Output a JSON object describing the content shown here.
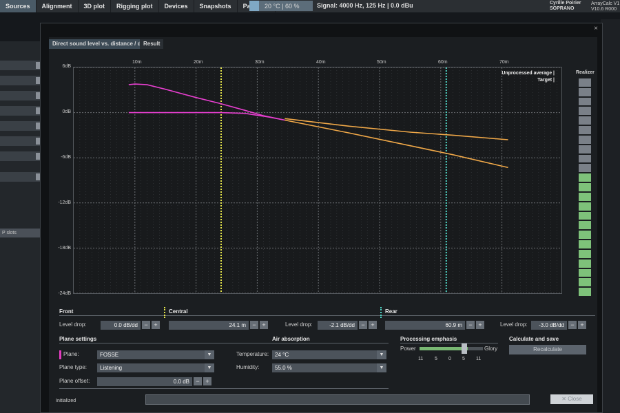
{
  "app": {
    "tabs": [
      "Sources",
      "Alignment",
      "3D plot",
      "Rigging plot",
      "Devices",
      "Snapshots",
      "Parts list"
    ],
    "temperature": "20 °C | 60 %",
    "signal": "Signal: 4000 Hz, 125 Hz | 0.0 dBu",
    "user_line1": "Cyrille Poirier",
    "user_line2": "SOPRANO",
    "app_name": "ArrayCalc V1",
    "version": "V10.6 R000",
    "left_slots_label": "P slots"
  },
  "dialog": {
    "tabs": [
      "Direct sound level vs. distance / dB",
      "Result"
    ],
    "close_x": "×"
  },
  "chart_data": {
    "type": "line",
    "title": "Direct sound level vs. distance / dB",
    "x_ticks": [
      "10m",
      "20m",
      "30m",
      "40m",
      "50m",
      "60m",
      "70m"
    ],
    "y_ticks": [
      "6dB",
      "0dB",
      "-6dB",
      "-12dB",
      "-18dB",
      "-24dB"
    ],
    "xlim": [
      0,
      75
    ],
    "ylim": [
      -24,
      6
    ],
    "series": [
      {
        "name": "Unprocessed average",
        "color": "#e83fd0",
        "x": [
          9,
          10,
          12,
          15,
          20,
          24,
          28,
          31,
          34.5
        ],
        "y": [
          3.7,
          3.8,
          3.7,
          3.1,
          2.0,
          1.2,
          0.3,
          -0.4,
          -1.0
        ]
      },
      {
        "name": "Target",
        "color": "#e83fd0",
        "x": [
          9,
          24,
          28,
          32,
          34.5
        ],
        "y": [
          0,
          0,
          -0.1,
          -0.6,
          -1.0
        ]
      },
      {
        "name": "Unprocessed average",
        "color": "#f0a848",
        "x": [
          34.5,
          45,
          55,
          62,
          71
        ],
        "y": [
          -1.0,
          -2.7,
          -4.4,
          -5.6,
          -7.3
        ]
      },
      {
        "name": "Target",
        "color": "#f0a848",
        "x": [
          34.5,
          45,
          55,
          62,
          71
        ],
        "y": [
          -0.8,
          -1.8,
          -2.6,
          -3.0,
          -3.6
        ]
      }
    ],
    "markers": [
      {
        "x": 24.1,
        "color": "#e6e64a"
      },
      {
        "x": 60.9,
        "color": "#4fd6c6"
      }
    ],
    "legend": [
      "Unprocessed average |",
      "Target |"
    ],
    "legend_position": "top-right",
    "grid": true
  },
  "realizer": {
    "label": "Realizer",
    "segments": 23,
    "lit": 13
  },
  "zones": {
    "front": {
      "title": "Front",
      "level_label": "Level drop:",
      "level": "0.0 dB/dd"
    },
    "central": {
      "title": "Central",
      "distance": "24.1 m",
      "level_label": "Level drop:",
      "level": "-2.1 dB/dd"
    },
    "rear": {
      "title": "Rear",
      "distance": "60.9 m",
      "level_label": "Level drop:",
      "level": "-3.0 dB/dd"
    },
    "minus": "−",
    "plus": "+"
  },
  "plane": {
    "title": "Plane settings",
    "plane_label": "Plane:",
    "plane_value": "FOSSE",
    "type_label": "Plane type:",
    "type_value": "Listening",
    "offset_label": "Plane offset:",
    "offset_value": "0.0 dB",
    "dropdown_glyph": "▼"
  },
  "air": {
    "title": "Air absorption",
    "temp_label": "Temperature:",
    "temp_value": "24 °C",
    "hum_label": "Humidity:",
    "hum_value": "55.0 %"
  },
  "emphasis": {
    "title": "Processing emphasis",
    "left": "Power",
    "right": "Glory",
    "ticks": [
      "11",
      "5",
      "0",
      "5",
      "11"
    ]
  },
  "calc": {
    "title": "Calculate and save",
    "button": "Recalculate"
  },
  "footer": {
    "status": "Initialized",
    "close": "✕ Close"
  }
}
